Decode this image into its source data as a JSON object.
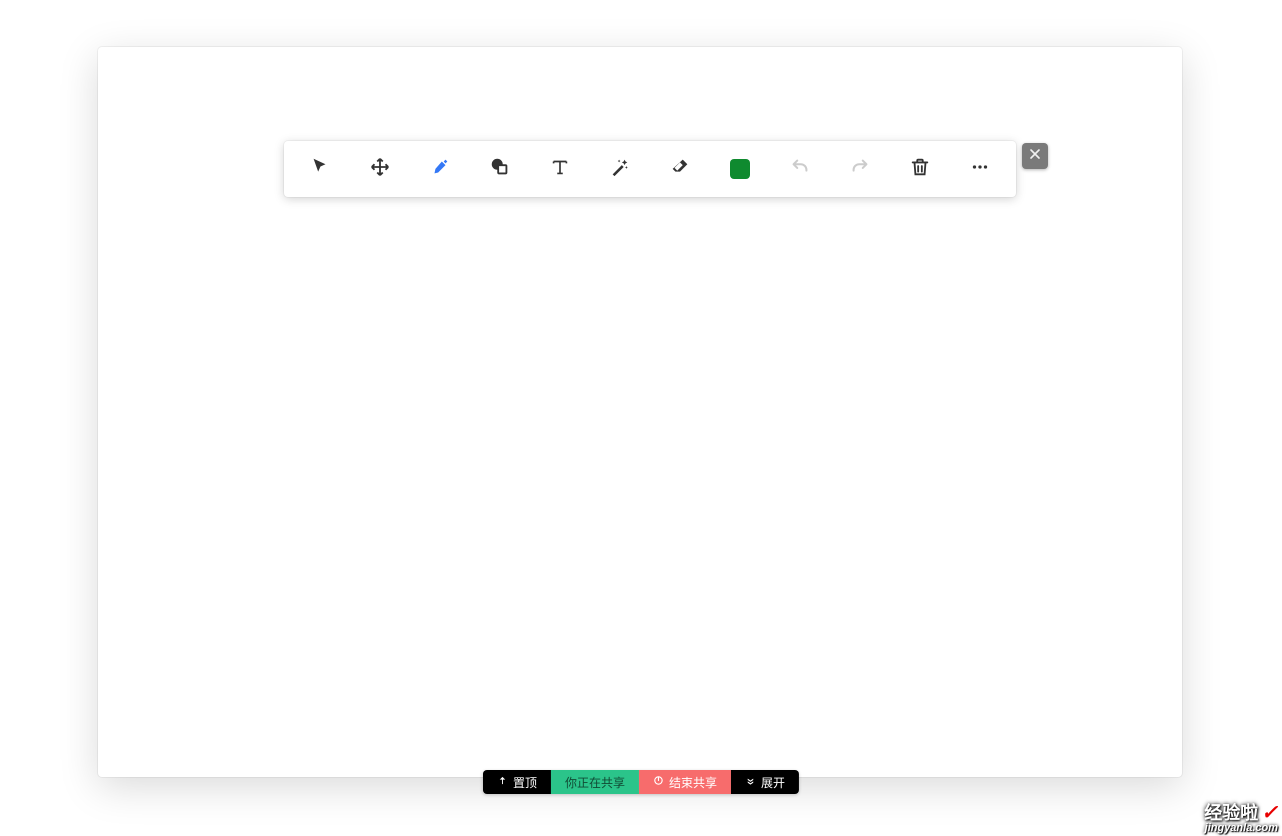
{
  "toolbar": {
    "tools": [
      {
        "name": "pointer",
        "icon": "cursor-icon"
      },
      {
        "name": "move",
        "icon": "move-icon"
      },
      {
        "name": "marker",
        "icon": "marker-icon",
        "active": true
      },
      {
        "name": "shape",
        "icon": "shape-icon"
      },
      {
        "name": "text",
        "icon": "text-icon"
      },
      {
        "name": "wand",
        "icon": "wand-icon"
      },
      {
        "name": "eraser",
        "icon": "eraser-icon"
      },
      {
        "name": "color",
        "icon": "color-swatch"
      },
      {
        "name": "undo",
        "icon": "undo-icon",
        "disabled": true
      },
      {
        "name": "redo",
        "icon": "redo-icon",
        "disabled": true
      },
      {
        "name": "trash",
        "icon": "trash-icon"
      },
      {
        "name": "more",
        "icon": "more-icon"
      }
    ],
    "color_swatch": "#0f8a2f",
    "marker_color": "#3478f6"
  },
  "status_bar": {
    "pin_label": "置顶",
    "sharing_label": "你正在共享",
    "stop_label": "结束共享",
    "expand_label": "展开"
  },
  "watermark": {
    "line1": "经验啦",
    "line2": "jingyanla.com"
  }
}
